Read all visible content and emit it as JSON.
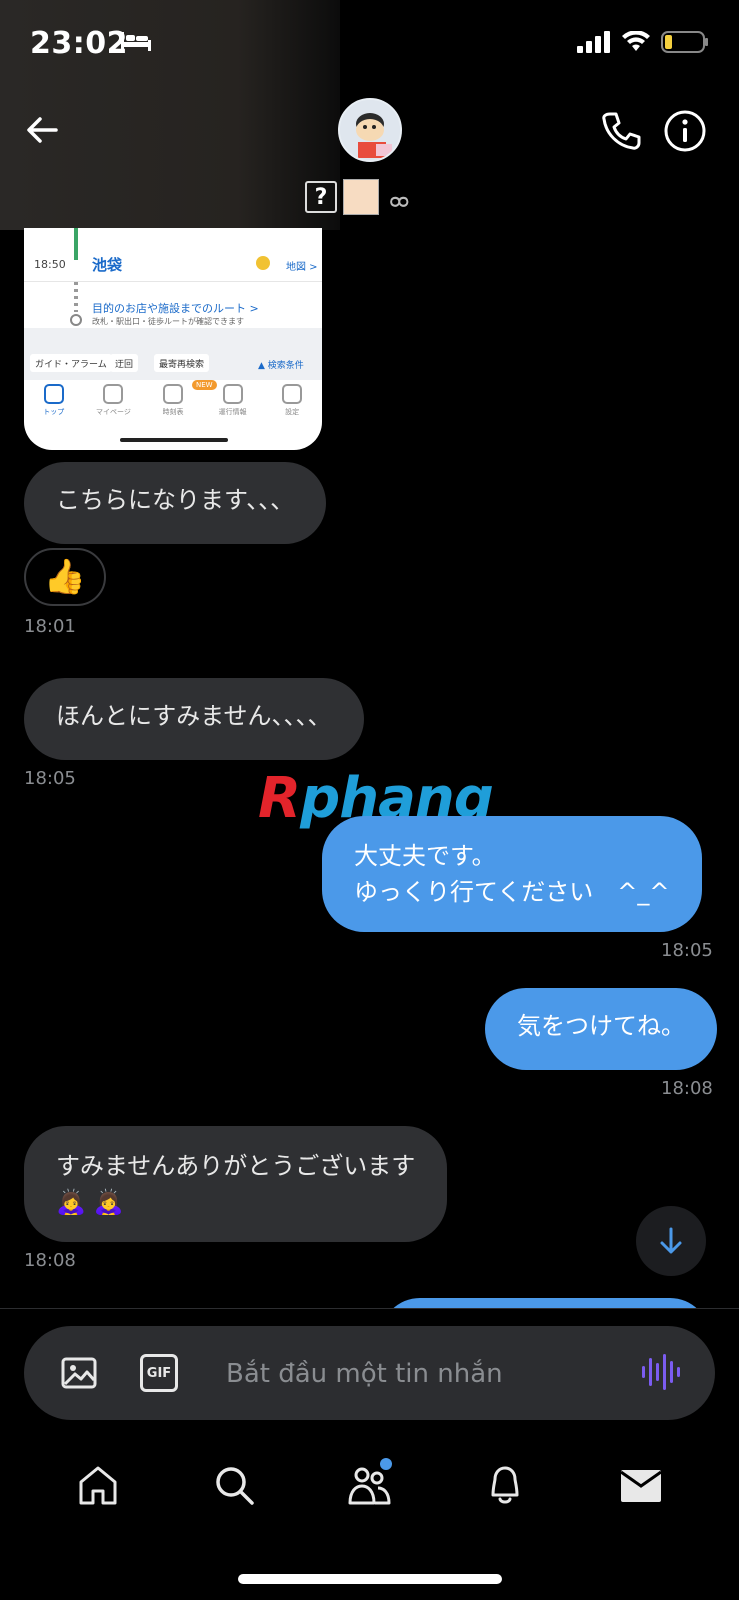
{
  "status": {
    "time": "23:02"
  },
  "header": {
    "glyph_box": "?",
    "glyph_loop": "ᢁ"
  },
  "image_message": {
    "time": "18:50",
    "station": "池袋",
    "map_link": "地図 >",
    "route_link": "目的のお店や施設までのルート >",
    "route_sub": "改札・駅出口・徒歩ルートが確認できます",
    "chips": [
      "ガイド・アラーム",
      "迂回",
      "最寄再検索"
    ],
    "search_cond": "▲ 検索条件",
    "tabs": [
      "トップ",
      "マイページ",
      "時刻表",
      "運行情報",
      "設定"
    ],
    "new_badge": "NEW"
  },
  "messages": [
    {
      "dir": "in",
      "text": "こちらになります、、、"
    },
    {
      "dir": "in",
      "reaction": "👍",
      "time": "18:01"
    },
    {
      "dir": "in",
      "text": "ほんとにすみません、、、、",
      "time": "18:05"
    },
    {
      "dir": "out",
      "line1": "大丈夫です。",
      "line2": "ゆっくり行てください　^_^",
      "time": "18:05"
    },
    {
      "dir": "out",
      "text": "気をつけてね。",
      "time": "18:08"
    },
    {
      "dir": "in",
      "line1": "すみませんありがとうございます",
      "line2": "🙇‍♀️ 🙇‍♀️",
      "time": "18:08"
    }
  ],
  "watermark": {
    "first": "R",
    "rest": "phang"
  },
  "composer": {
    "gif_label": "GIF",
    "placeholder": "Bắt đầu một tin nhắn"
  },
  "nav": {
    "items": [
      "home-icon",
      "search-icon",
      "communities-icon",
      "bell-icon",
      "mail-icon"
    ]
  },
  "colors": {
    "outgoing": "#4b99e9",
    "incoming": "#2f3033",
    "background": "#000000",
    "voice_accent": "#7b5cf0"
  }
}
